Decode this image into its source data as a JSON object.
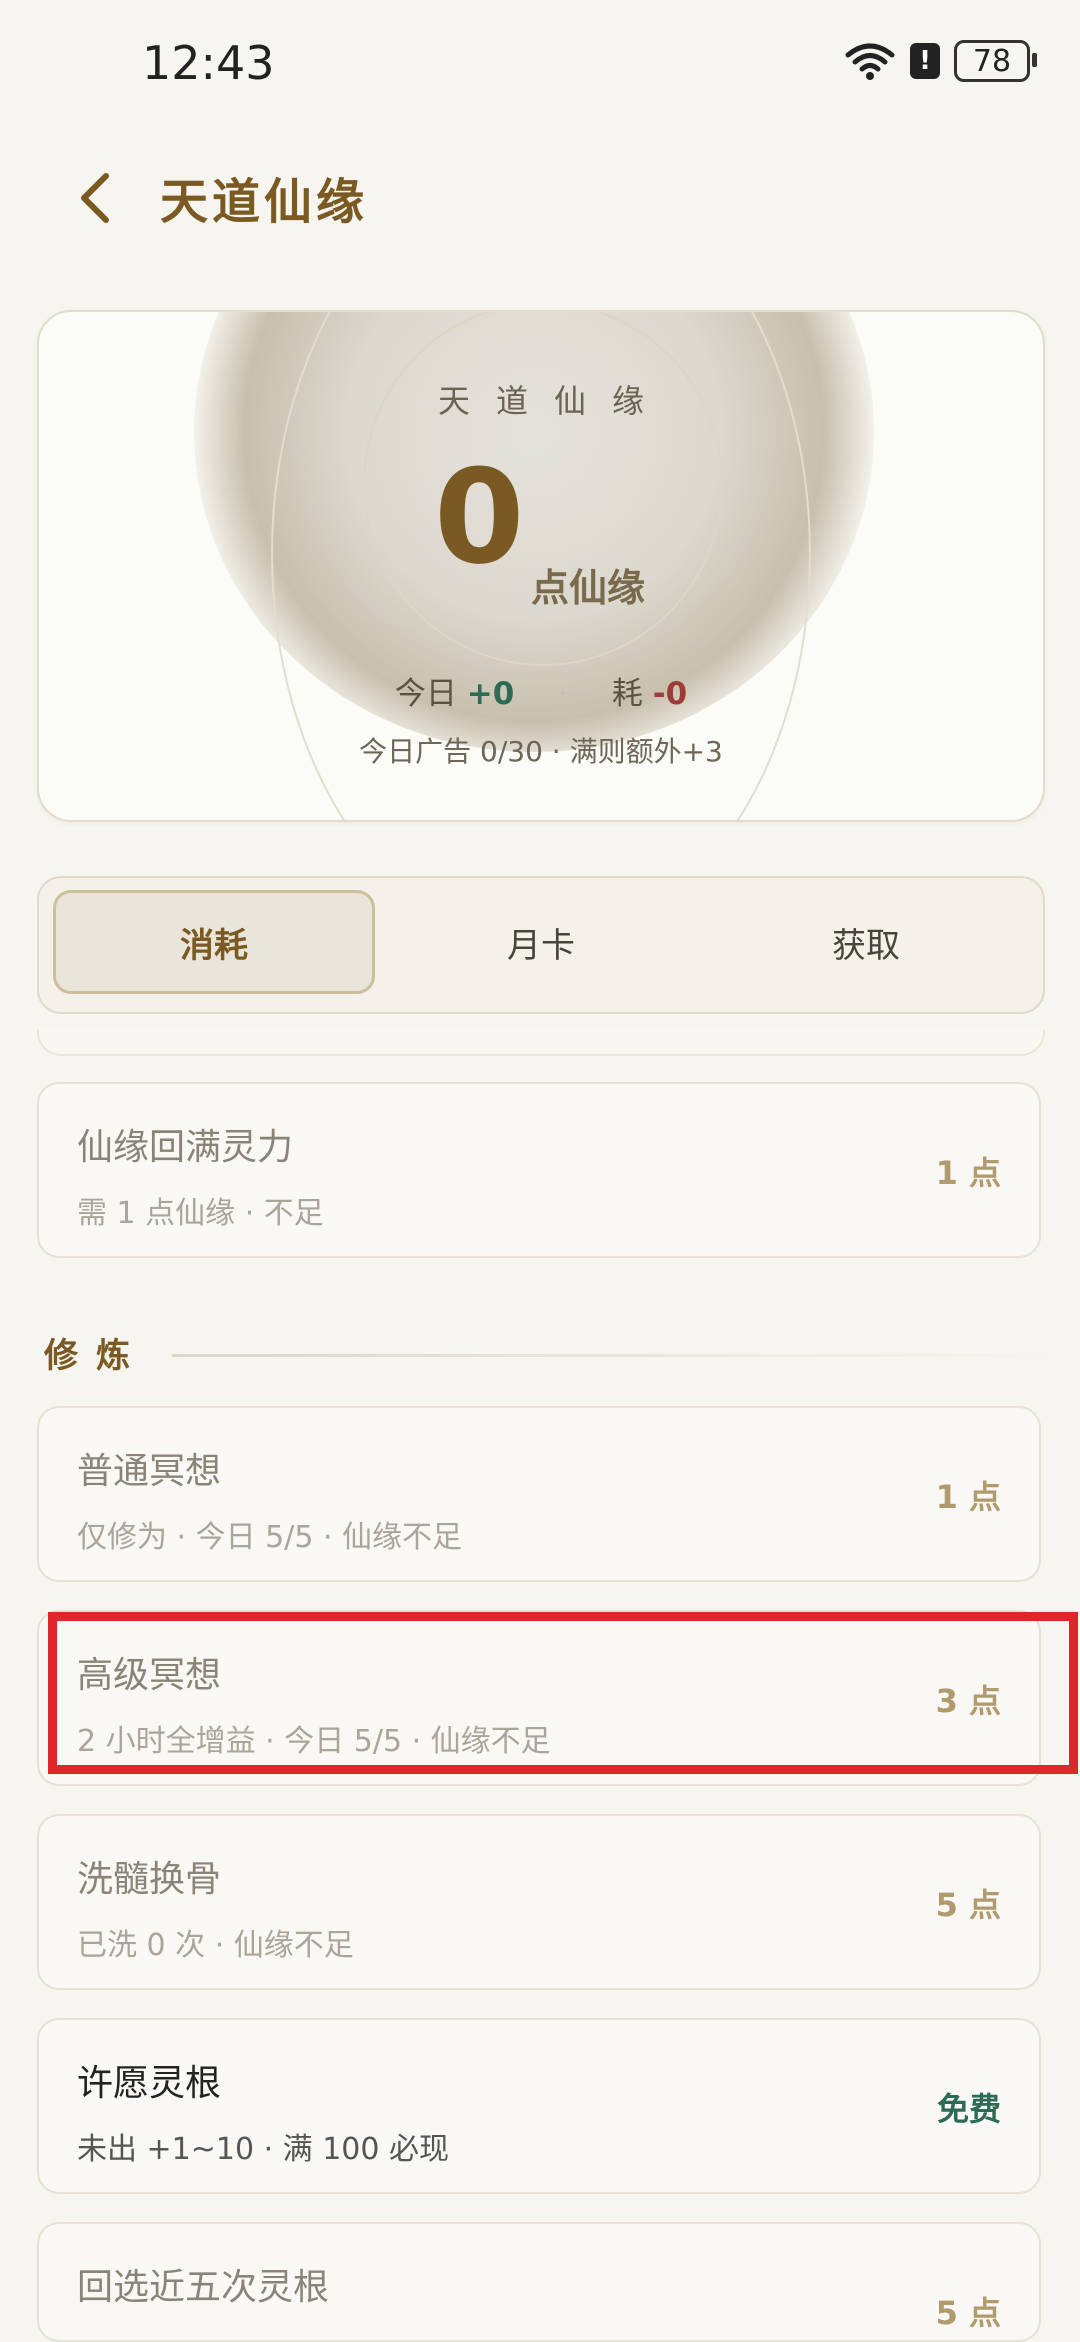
{
  "status_bar": {
    "time": "12:43",
    "battery": "78"
  },
  "header": {
    "title": "天道仙缘"
  },
  "hero": {
    "label": "天道仙缘",
    "points": "0",
    "unit": "点仙缘",
    "today_label": "今日",
    "today_gain": "+0",
    "consume_label": "耗",
    "consume_value": "-0",
    "ad_info": "今日广告 0/30 · 满则额外+3"
  },
  "tabs": [
    {
      "label": "消耗",
      "active": true
    },
    {
      "label": "月卡",
      "active": false
    },
    {
      "label": "获取",
      "active": false
    }
  ],
  "items_top": [
    {
      "name": "仙缘回满灵力",
      "desc": "需 1 点仙缘 · 不足",
      "cost": "1 点"
    }
  ],
  "section": {
    "title": "修炼"
  },
  "items": [
    {
      "name": "普通冥想",
      "desc": "仅修为 · 今日 5/5 · 仙缘不足",
      "cost": "1 点"
    },
    {
      "name": "高级冥想",
      "desc": "2 小时全增益 · 今日 5/5 · 仙缘不足",
      "cost": "3 点"
    },
    {
      "name": "洗髓换骨",
      "desc": "已洗 0 次 · 仙缘不足",
      "cost": "5 点"
    },
    {
      "name": "许愿灵根",
      "desc": "未出 +1~10 · 满 100 必现",
      "cost": "免费"
    },
    {
      "name": "回选近五次灵根",
      "desc": "",
      "cost": "5 点"
    }
  ],
  "colors": {
    "accent": "#7a5a22",
    "positive": "#2d6b55",
    "negative": "#9d3b3b",
    "highlight": "#e0262a"
  }
}
